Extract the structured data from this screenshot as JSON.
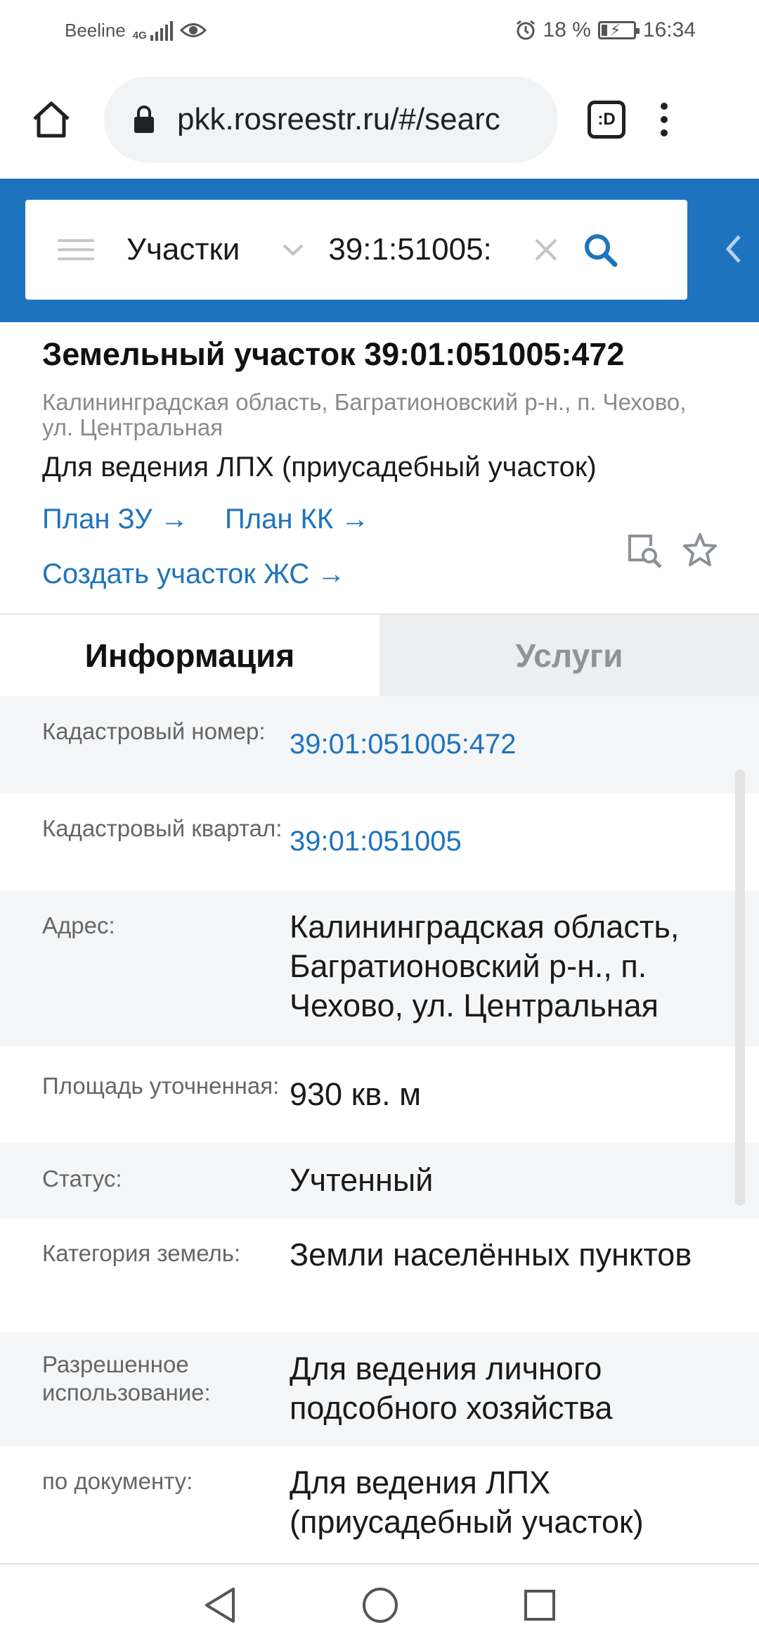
{
  "status_bar": {
    "carrier": "Beeline",
    "network": "4G",
    "battery": "18 %",
    "time": "16:34"
  },
  "browser": {
    "url": "pkk.rosreestr.ru/#/searc",
    "tabs_label": ":D"
  },
  "search": {
    "type_value": "Участки",
    "query_value": "39:1:51005:"
  },
  "object": {
    "title": "Земельный участок 39:01:051005:472",
    "address": "Калининградская область, Багратионовский р-н., п. Чехово, ул. Центральная",
    "purpose": "Для ведения ЛПХ (приусадебный участок)",
    "links": {
      "plan_zu": "План ЗУ →",
      "plan_kk": "План КК →",
      "create": "Создать участок ЖС →"
    }
  },
  "tabs": {
    "info": "Информация",
    "services": "Услуги"
  },
  "info_rows": [
    {
      "label": "Кадастровый номер:",
      "value": "39:01:051005:472"
    },
    {
      "label": "Кадастровый квартал:",
      "value": "39:01:051005"
    },
    {
      "label": "Адрес:",
      "value": "Калининградская область, Багратионовский р-н., п. Чехово, ул. Центральная"
    },
    {
      "label": "Площадь уточненная:",
      "value": "930 кв. м"
    },
    {
      "label": "Статус:",
      "value": "Учтенный"
    },
    {
      "label": "Категория земель:",
      "value": "Земли населённых пунктов"
    },
    {
      "label": "Разрешенное использование:",
      "value": "Для ведения личного подсобного хозяйства"
    },
    {
      "label": "по документу:",
      "value": "Для ведения ЛПХ (приусадебный участок)"
    }
  ],
  "colors": {
    "accent": "#1e73be",
    "header": "#1e73be"
  }
}
